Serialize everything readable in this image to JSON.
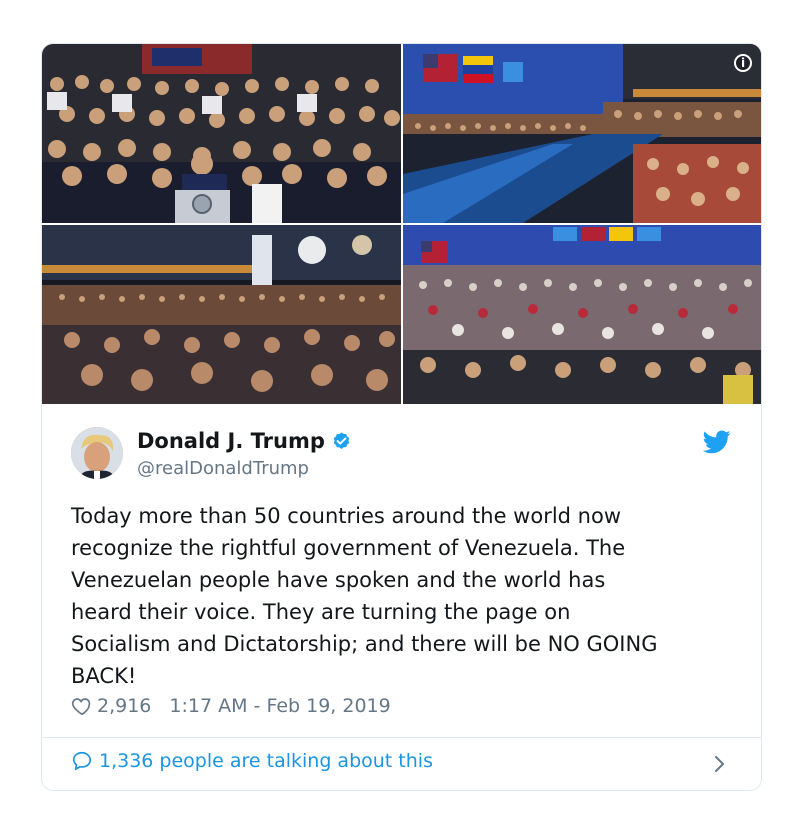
{
  "tweet": {
    "author_name": "Donald J. Trump",
    "handle": "@realDonaldTrump",
    "text": "Today more than 50 countries around the world now\nrecognize the rightful government of Venezuela. The\nVenezuelan people have spoken and the world has\nheard their voice. They are turning the page on\nSocialism and Dictatorship; and there will be NO GOING\nBACK!",
    "likes": "2,916",
    "timestamp": "1:17 AM - Feb 19, 2019",
    "talking_text": "1,336 people are talking about this"
  },
  "media": {
    "photos": [
      {
        "subject": "rally-crowd-with-podium"
      },
      {
        "subject": "arena-with-flags"
      },
      {
        "subject": "arena-crowd-lights"
      },
      {
        "subject": "arena-floor-crowd"
      }
    ],
    "info_icon": "info-icon"
  },
  "colors": {
    "link": "#1b95e0",
    "verified": "#1da1f2",
    "meta_text": "#657786",
    "border": "#e1e8ed"
  }
}
